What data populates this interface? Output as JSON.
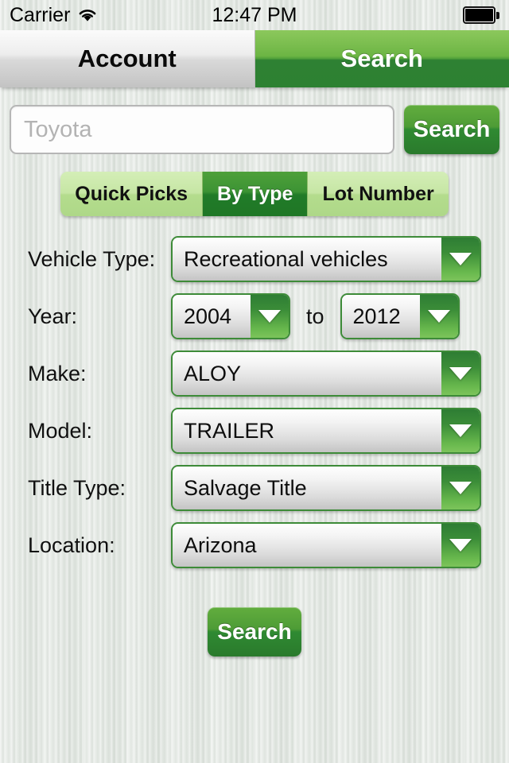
{
  "status_bar": {
    "carrier": "Carrier",
    "wifi_icon": "wifi-icon",
    "time": "12:47 PM",
    "battery_icon": "battery-full-icon"
  },
  "tabs": [
    {
      "label": "Account",
      "active": false
    },
    {
      "label": "Search",
      "active": true
    }
  ],
  "search": {
    "input_value": "",
    "placeholder": "Toyota",
    "button_label": "Search"
  },
  "segments": [
    {
      "label": "Quick Picks",
      "selected": false
    },
    {
      "label": "By Type",
      "selected": true
    },
    {
      "label": "Lot Number",
      "selected": false
    }
  ],
  "form": {
    "vehicle_type": {
      "label": "Vehicle Type:",
      "value": "Recreational vehicles"
    },
    "year": {
      "label": "Year:",
      "from": "2004",
      "to_word": "to",
      "to": "2012"
    },
    "make": {
      "label": "Make:",
      "value": "ALOY"
    },
    "model": {
      "label": "Model:",
      "value": "TRAILER"
    },
    "title_type": {
      "label": "Title Type:",
      "value": "Salvage Title"
    },
    "location": {
      "label": "Location:",
      "value": "Arizona"
    }
  },
  "submit": {
    "label": "Search"
  },
  "colors": {
    "accent_green": "#2d8132",
    "light_green": "#8cc85c",
    "segment_off": "#c6e6a4",
    "background": "#e3e8e3",
    "border_green": "#3d8b38"
  }
}
